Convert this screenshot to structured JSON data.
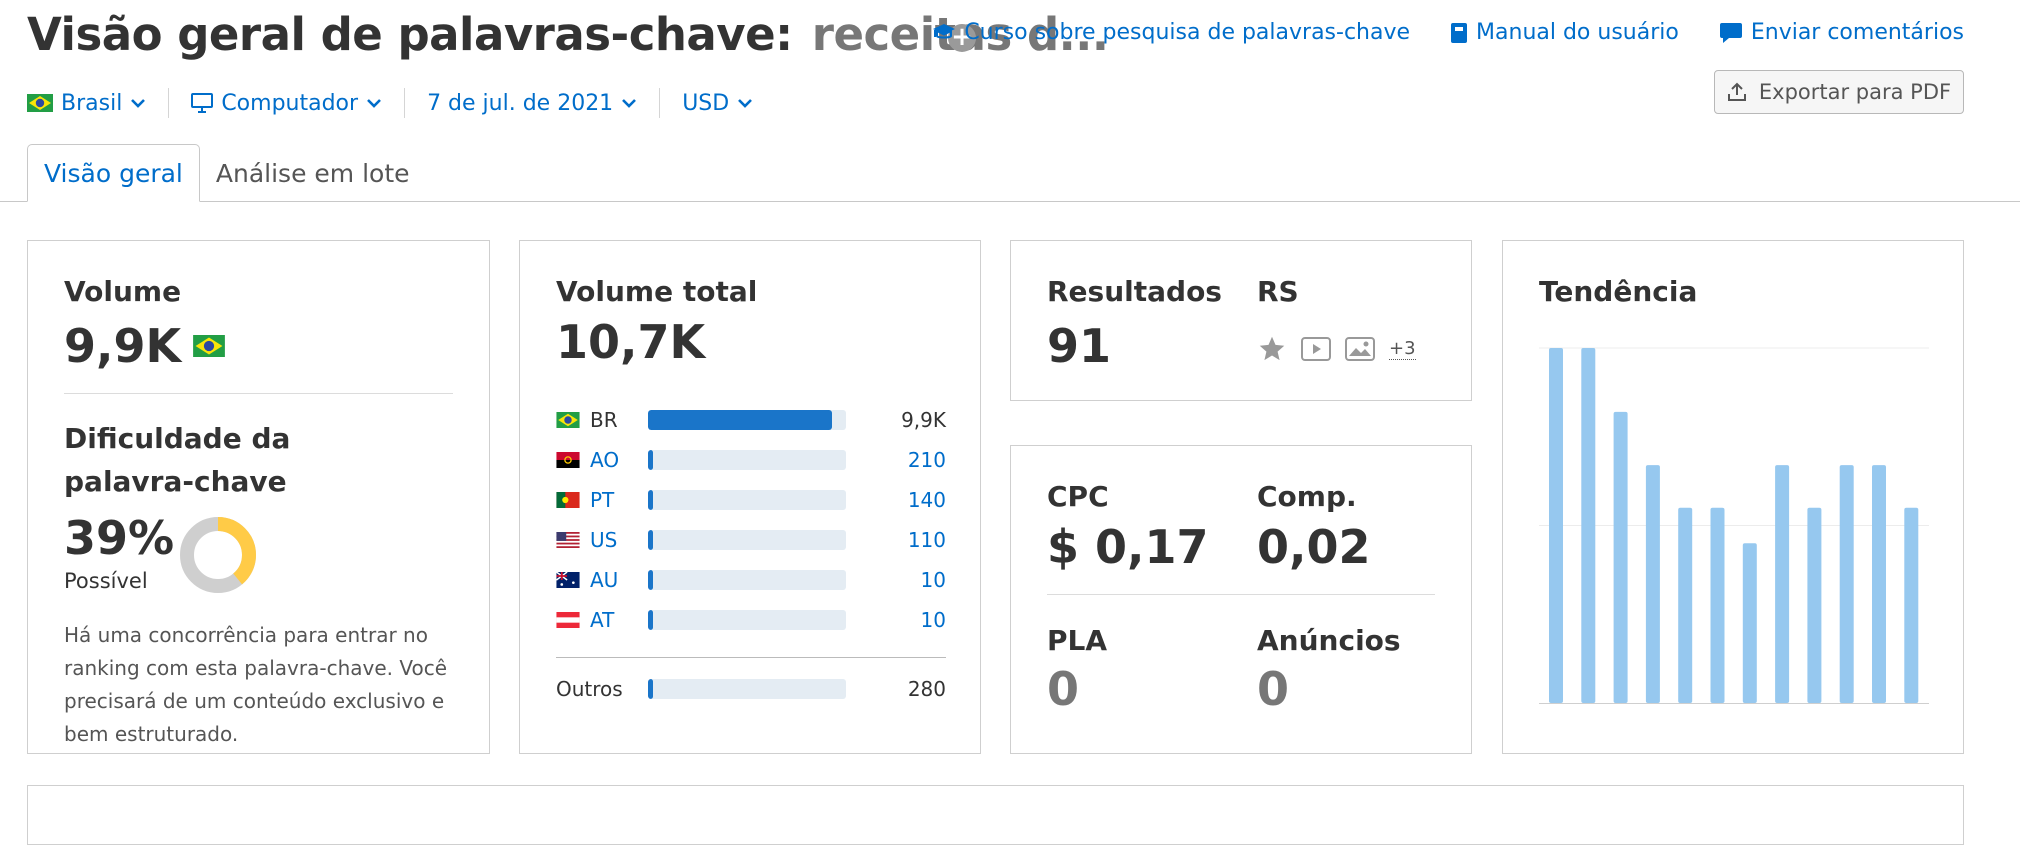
{
  "header": {
    "title": "Visão geral de palavras-chave:",
    "query": "receitas d...",
    "links": [
      {
        "label": "Curso sobre pesquisa de palavras-chave",
        "icon": "graduation-cap-icon"
      },
      {
        "label": "Manual do usuário",
        "icon": "book-icon"
      },
      {
        "label": "Enviar comentários",
        "icon": "speech-bubble-icon"
      }
    ],
    "export_label": "Exportar para PDF"
  },
  "filters": {
    "country": "Brasil",
    "device": "Computador",
    "date": "7 de jul. de 2021",
    "currency": "USD"
  },
  "tabs": [
    {
      "label": "Visão geral",
      "active": true
    },
    {
      "label": "Análise em lote",
      "active": false
    }
  ],
  "volume_card": {
    "title": "Volume",
    "value": "9,9K",
    "kd_title": "Dificuldade da palavra-chave",
    "kd_value": "39%",
    "kd_level": "Possível",
    "kd_percent": 39,
    "kd_description": "Há uma concorrência para entrar no ranking com esta palavra-chave. Você precisará de um conteúdo exclusivo e bem estruturado."
  },
  "total_card": {
    "title": "Volume total",
    "value": "10,7K",
    "rows": [
      {
        "code": "BR",
        "value": "9,9K",
        "fraction": 0.93
      },
      {
        "code": "AO",
        "value": "210",
        "fraction": 0.02
      },
      {
        "code": "PT",
        "value": "140",
        "fraction": 0.015
      },
      {
        "code": "US",
        "value": "110",
        "fraction": 0.012
      },
      {
        "code": "AU",
        "value": "10",
        "fraction": 0.004
      },
      {
        "code": "AT",
        "value": "10",
        "fraction": 0.004
      }
    ],
    "other": {
      "code": "Outros",
      "value": "280",
      "fraction": 0.025
    }
  },
  "results_card": {
    "results_label": "Resultados",
    "results_value": "91",
    "serp_label": "RS",
    "serp_more": "+3",
    "serp_icons": [
      "star-icon",
      "video-icon",
      "image-icon"
    ]
  },
  "cpc_card": {
    "cpc_label": "CPC",
    "cpc_value": "$ 0,17",
    "comp_label": "Comp.",
    "comp_value": "0,02",
    "pla_label": "PLA",
    "pla_value": "0",
    "ads_label": "Anúncios",
    "ads_value": "0"
  },
  "trend_card": {
    "title": "Tendência",
    "bars": [
      1.0,
      1.0,
      0.82,
      0.67,
      0.55,
      0.55,
      0.45,
      0.67,
      0.55,
      0.67,
      0.67,
      0.55
    ]
  },
  "colors": {
    "accent": "#006dca",
    "bar_fill": "#1a75c9",
    "trend_bar": "#96c8ef",
    "kd_yellow": "#ffcb47"
  }
}
